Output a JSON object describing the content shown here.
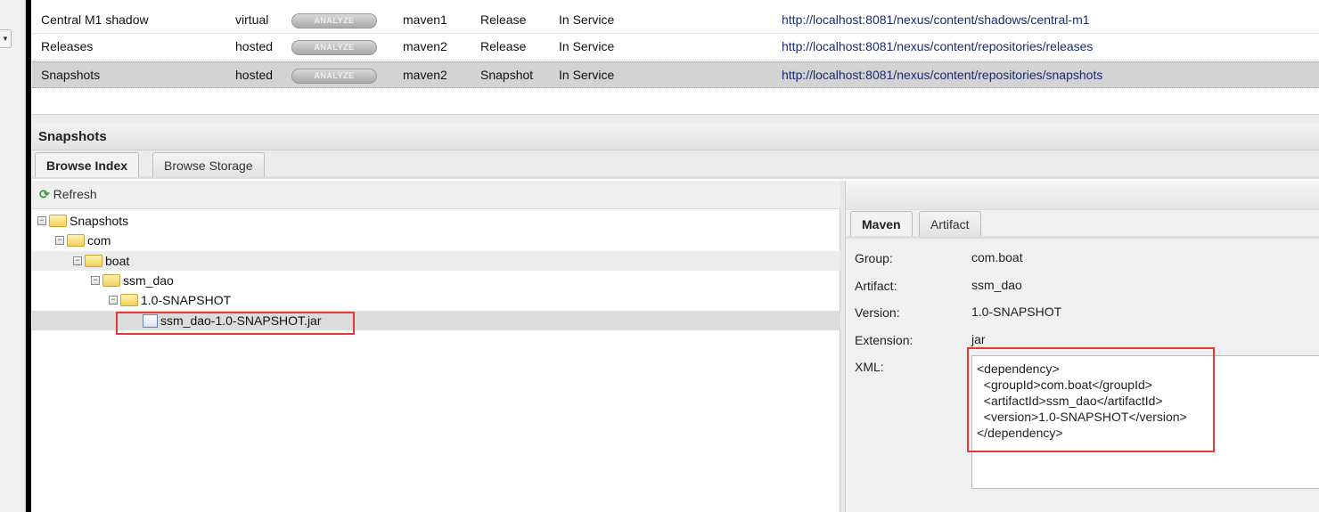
{
  "repositories": [
    {
      "name": "Central M1 shadow",
      "type": "virtual",
      "analyze": "ANALYZE",
      "format": "maven1",
      "policy": "Release",
      "status": "In Service",
      "url": "http://localhost:8081/nexus/content/shadows/central-m1"
    },
    {
      "name": "Releases",
      "type": "hosted",
      "analyze": "ANALYZE",
      "format": "maven2",
      "policy": "Release",
      "status": "In Service",
      "url": "http://localhost:8081/nexus/content/repositories/releases"
    },
    {
      "name": "Snapshots",
      "type": "hosted",
      "analyze": "ANALYZE",
      "format": "maven2",
      "policy": "Snapshot",
      "status": "In Service",
      "url": "http://localhost:8081/nexus/content/repositories/snapshots"
    }
  ],
  "panel": {
    "title": "Snapshots",
    "tabs": [
      "Browse Index",
      "Browse Storage"
    ],
    "refresh": "Refresh"
  },
  "tree": [
    "Snapshots",
    "com",
    "boat",
    "ssm_dao",
    "1.0-SNAPSHOT",
    "ssm_dao-1.0-SNAPSHOT.jar"
  ],
  "detail": {
    "tabs": [
      "Maven",
      "Artifact"
    ],
    "labels": {
      "group": "Group:",
      "artifact": "Artifact:",
      "version": "Version:",
      "extension": "Extension:",
      "xml": "XML:"
    },
    "values": {
      "group": "com.boat",
      "artifact": "ssm_dao",
      "version": "1.0-SNAPSHOT",
      "extension": "jar"
    },
    "xml": "<dependency>\n  <groupId>com.boat</groupId>\n  <artifactId>ssm_dao</artifactId>\n  <version>1.0-SNAPSHOT</version>\n</dependency>"
  },
  "colors": {
    "highlight": "#e53935",
    "selected_row": "#d3d3d3"
  }
}
